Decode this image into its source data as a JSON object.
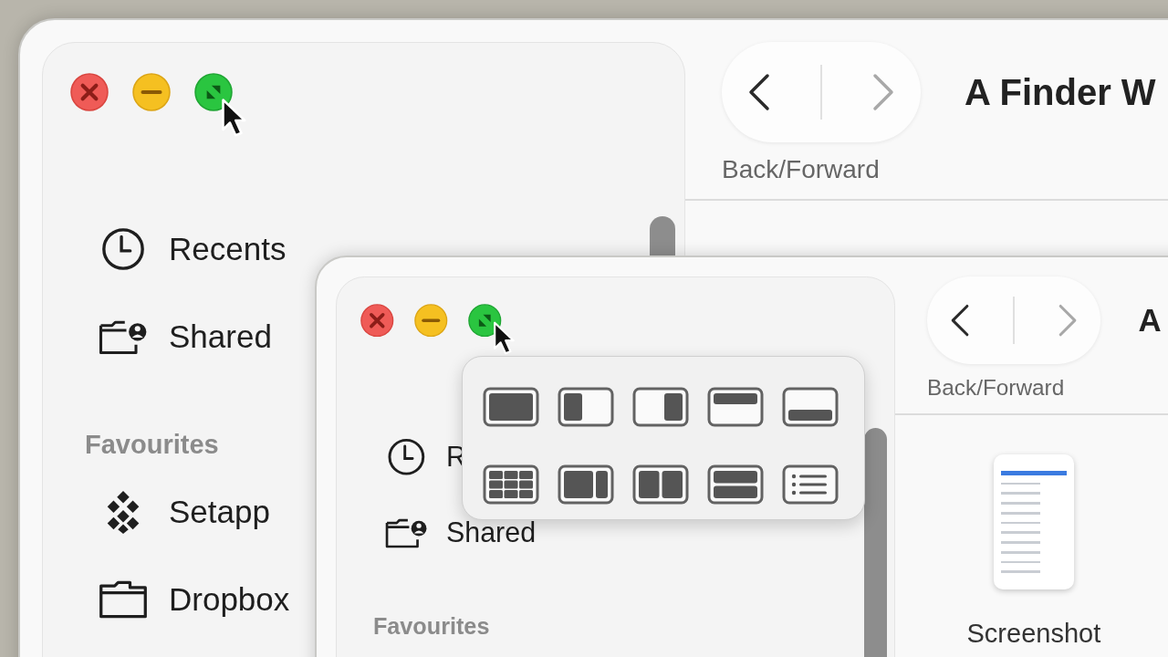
{
  "back_window": {
    "title": "A Finder W",
    "nav_caption": "Back/Forward",
    "nav": {
      "back_disabled": false,
      "forward_disabled": true
    },
    "sidebar": [
      {
        "kind": "recents",
        "label": "Recents"
      },
      {
        "kind": "shared",
        "label": "Shared"
      },
      {
        "kind": "heading",
        "label": "Favourites"
      },
      {
        "kind": "app",
        "label": "Setapp"
      },
      {
        "kind": "folder",
        "label": "Dropbox"
      }
    ]
  },
  "front_window": {
    "title": "A",
    "nav_caption": "Back/Forward",
    "nav": {
      "back_disabled": false,
      "forward_disabled": true
    },
    "sidebar": [
      {
        "kind": "recents",
        "label": "R"
      },
      {
        "kind": "shared",
        "label": "Shared"
      },
      {
        "kind": "heading",
        "label": "Favourites"
      }
    ],
    "files": [
      {
        "name": "Screenshot"
      }
    ]
  }
}
